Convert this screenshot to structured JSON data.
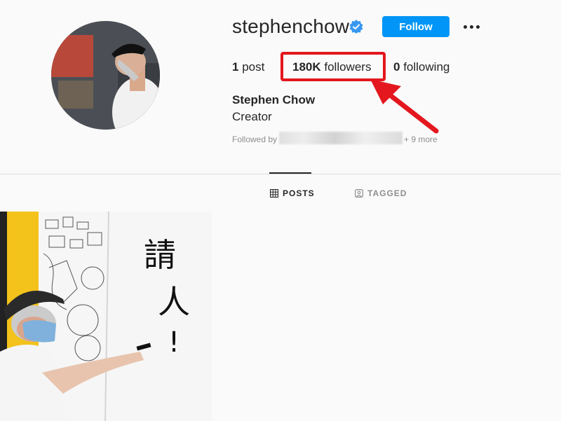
{
  "profile": {
    "username": "stephenchow",
    "verified_icon": "verified-badge-icon",
    "follow_label": "Follow",
    "more_icon": "more-options-icon",
    "stats": {
      "posts_count": "1",
      "posts_label": "post",
      "followers_count": "180K",
      "followers_label": "followers",
      "following_count": "0",
      "following_label": "following"
    },
    "full_name": "Stephen Chow",
    "category": "Creator",
    "followed_by_label": "Followed by",
    "followed_by_more": "+ 9 more"
  },
  "tabs": [
    {
      "label": "POSTS",
      "icon": "grid-icon",
      "active": true
    },
    {
      "label": "TAGGED",
      "icon": "tagged-icon",
      "active": false
    }
  ],
  "whiteboard": {
    "handwriting": "請人！"
  },
  "colors": {
    "accent": "#0095f6",
    "annotation": "#e3171d",
    "background": "#fafafa"
  }
}
